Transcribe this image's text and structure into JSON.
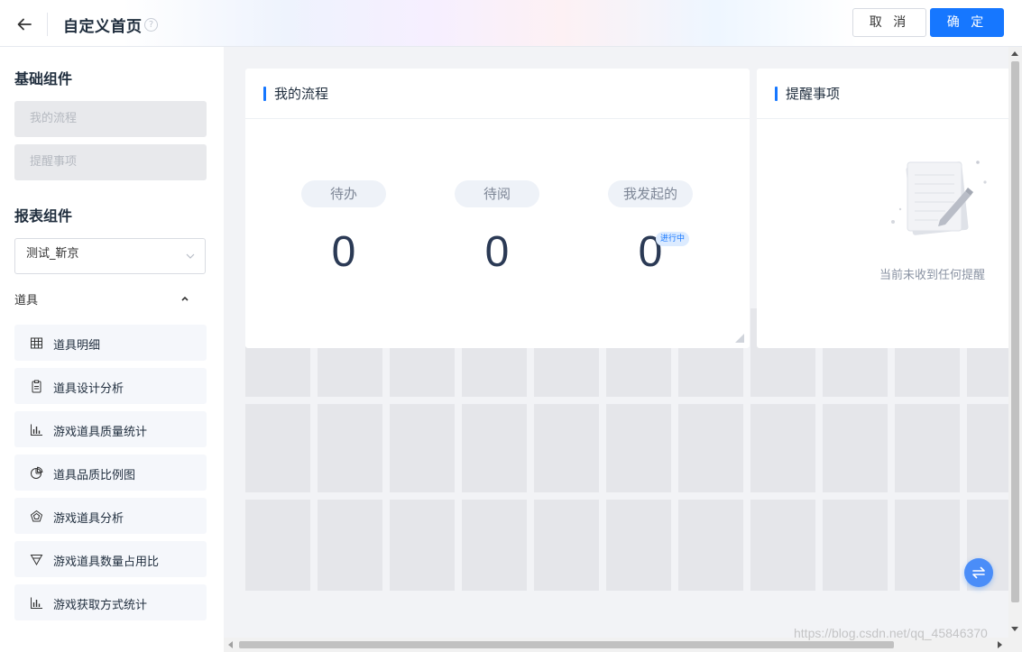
{
  "header": {
    "title": "自定义首页",
    "help_symbol": "?",
    "cancel_label": "取 消",
    "ok_label": "确 定"
  },
  "sidebar": {
    "basic_section_title": "基础组件",
    "basic_items": [
      {
        "label": "我的流程"
      },
      {
        "label": "提醒事项"
      }
    ],
    "report_section_title": "报表组件",
    "report_select": {
      "value": "测试_靳京"
    },
    "group": {
      "label": "道具",
      "expanded": true
    },
    "report_items": [
      {
        "label": "道具明细",
        "icon": "table-icon"
      },
      {
        "label": "道具设计分析",
        "icon": "clipboard-icon"
      },
      {
        "label": "游戏道具质量统计",
        "icon": "bar-chart-icon"
      },
      {
        "label": "道具品质比例图",
        "icon": "pie-chart-icon"
      },
      {
        "label": "游戏道具分析",
        "icon": "radar-chart-icon"
      },
      {
        "label": "游戏道具数量占用比",
        "icon": "funnel-icon"
      },
      {
        "label": "游戏获取方式统计",
        "icon": "bar-chart-icon"
      }
    ]
  },
  "main": {
    "flow_card": {
      "title": "我的流程",
      "stats": [
        {
          "label": "待办",
          "count": "0"
        },
        {
          "label": "待阅",
          "count": "0"
        },
        {
          "label": "我发起的",
          "count": "0",
          "badge": "进行中"
        }
      ]
    },
    "reminder_card": {
      "title": "提醒事项",
      "empty_text": "当前未收到任何提醒"
    }
  },
  "watermark": "https://blog.csdn.net/qq_45846370",
  "colors": {
    "primary": "#1677ff",
    "canvas_bg": "#f2f3f6",
    "grid_cell": "#e5e6ea",
    "count_text": "#2b3a55"
  }
}
